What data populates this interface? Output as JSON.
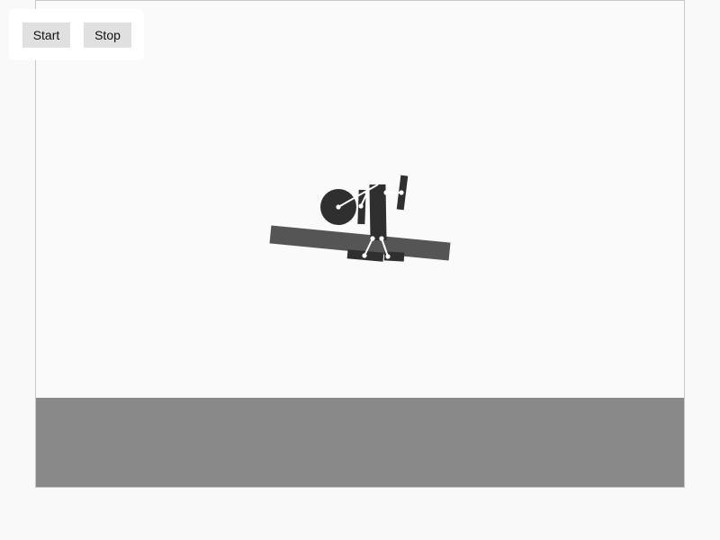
{
  "controls": {
    "start_label": "Start",
    "stop_label": "Stop"
  },
  "colors": {
    "page_background": "#f9f9f9",
    "world_background": "#fafafa",
    "world_border": "#c8c8c8",
    "ground": "#898989",
    "body_dark": "#2f2f2f",
    "body_medium": "#555555",
    "joint": "#ffffff",
    "button_background": "#e0e0e0",
    "button_text": "#111111"
  },
  "scene": {
    "bodies": [
      {
        "name": "wheel",
        "shape": "circle",
        "color": "body_dark"
      },
      {
        "name": "torso-plank",
        "shape": "rect",
        "color": "body_dark"
      },
      {
        "name": "small-plank",
        "shape": "rect",
        "color": "body_dark"
      },
      {
        "name": "right-arm",
        "shape": "rect",
        "color": "body_dark"
      },
      {
        "name": "seesaw-plank",
        "shape": "rect",
        "color": "body_medium"
      },
      {
        "name": "left-foot",
        "shape": "rect",
        "color": "body_dark"
      },
      {
        "name": "right-foot",
        "shape": "rect",
        "color": "body_dark"
      }
    ],
    "joints": [
      {
        "name": "wheel-hub"
      },
      {
        "name": "shoulder-left"
      },
      {
        "name": "shoulder-right"
      },
      {
        "name": "arm-pivot"
      },
      {
        "name": "hip-left"
      },
      {
        "name": "hip-right"
      },
      {
        "name": "ankle-left"
      },
      {
        "name": "ankle-right"
      }
    ]
  }
}
